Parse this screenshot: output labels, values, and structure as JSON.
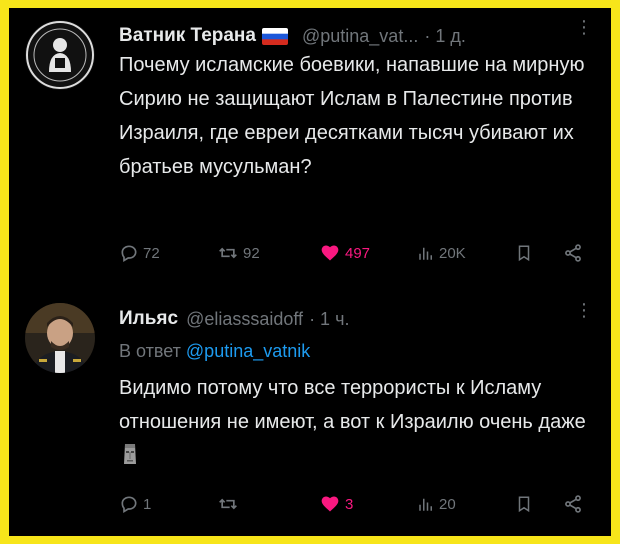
{
  "tweets": [
    {
      "author_name": "Ватник Терана",
      "flag_icon": "russian-flag-icon",
      "handle": "@putina_vat...",
      "time": "· 1 д.",
      "text": "Почему исламские боевики, напавшие на мирную Сирию не защищают Ислам в Палестине против Израиля, где евреи десятками тысяч убивают их братьев мусульман?",
      "stats": {
        "replies": "72",
        "retweets": "92",
        "likes": "497",
        "views": "20K"
      },
      "liked": true
    },
    {
      "author_name": "Ильяс",
      "handle": "@eliasssaidoff",
      "time": "· 1 ч.",
      "reply_prefix": "В ответ",
      "reply_handle": "@putina_vatnik",
      "text": "Видимо потому что все террористы к Исламу отношения не имеют, а вот к Израилю очень даже",
      "emoji_icon": "moai-icon",
      "stats": {
        "replies": "1",
        "retweets": "",
        "likes": "3",
        "views": "20"
      },
      "liked": true
    }
  ],
  "colors": {
    "background": "#000000",
    "border": "#f7e51a",
    "text": "#e7e9ea",
    "muted": "#71767b",
    "like": "#f91880",
    "link": "#1d9bf0"
  }
}
